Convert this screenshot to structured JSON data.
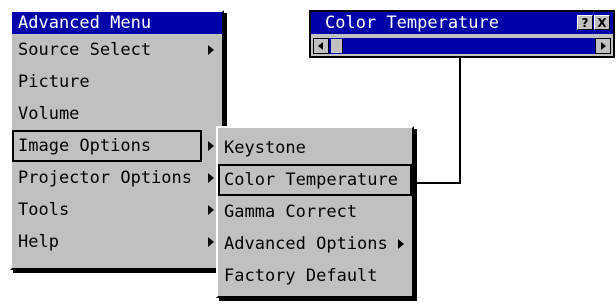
{
  "advanced_menu": {
    "title": "Advanced Menu",
    "items": [
      {
        "label": "Source Select",
        "submenu": true
      },
      {
        "label": "Picture",
        "submenu": false
      },
      {
        "label": "Volume",
        "submenu": false
      },
      {
        "label": "Image Options",
        "submenu": true,
        "selected": true
      },
      {
        "label": "Projector Options",
        "submenu": true
      },
      {
        "label": "Tools",
        "submenu": true
      },
      {
        "label": "Help",
        "submenu": true
      }
    ]
  },
  "image_options_menu": {
    "items": [
      {
        "label": "Keystone",
        "submenu": false
      },
      {
        "label": "Color Temperature",
        "submenu": false,
        "selected": true
      },
      {
        "label": "Gamma Correct",
        "submenu": false
      },
      {
        "label": "Advanced Options",
        "submenu": true
      },
      {
        "label": "Factory Default",
        "submenu": false
      }
    ]
  },
  "color_temperature_window": {
    "title": "Color Temperature",
    "help_button": "?",
    "close_button": "X"
  },
  "colors": {
    "menu_bg": "#c0c0c0",
    "title_bg": "#0000a8",
    "title_text": "#ffffff",
    "text": "#000000"
  }
}
